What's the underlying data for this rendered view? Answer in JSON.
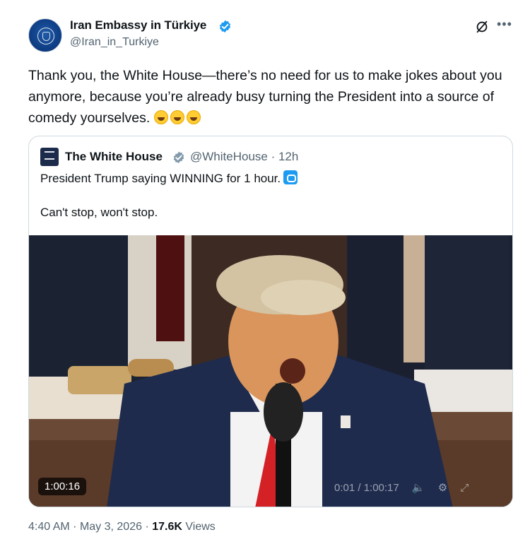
{
  "author": {
    "name": "Iran Embassy in Türkiye",
    "handle": "@Iran_in_Turkiye",
    "verified_color": "#1d9bf0"
  },
  "post": {
    "text": "Thank you, the White House—there’s no need for us to make jokes about you anymore, because you’re already busy turning the President into a source of comedy yourselves.",
    "emoji_icons": [
      "rolling-on-floor-laughing-icon",
      "rolling-on-floor-laughing-icon",
      "rolling-on-floor-laughing-icon"
    ]
  },
  "quote": {
    "name": "The White House",
    "handle_time": "@WhiteHouse · 12h",
    "badge_color": "#829aab",
    "line1": "President Trump saying WINNING for 1 hour.",
    "line2": "Can't stop, won't stop.",
    "video": {
      "duration_chip": "1:00:16",
      "time_progress": "0:01 / 1:00:17",
      "icons": [
        "volume-muted-icon",
        "settings-icon",
        "fullscreen-icon"
      ]
    }
  },
  "footer": {
    "time": "4:40 AM",
    "date": "May 3, 2026",
    "views_count": "17.6K",
    "views_label": "Views"
  },
  "header_icons": [
    "grok-icon",
    "more-options-icon"
  ]
}
